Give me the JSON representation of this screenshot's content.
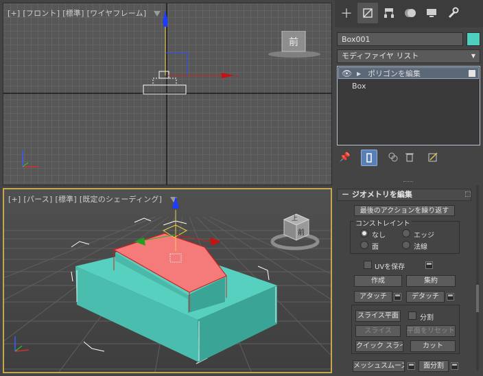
{
  "viewports": {
    "front": {
      "plus": "[+]",
      "view": "[フロント]",
      "mode": "[標準]",
      "shading": "[ワイヤフレーム]",
      "cube_label": "前"
    },
    "perspective": {
      "plus": "[+]",
      "view": "[パース]",
      "mode": "[標準]",
      "shading": "[既定のシェーディング]",
      "cube_label_top": "上",
      "cube_label_front": "前"
    }
  },
  "panel": {
    "tabs": [
      {
        "name": "create",
        "icon": "plus-icon"
      },
      {
        "name": "modify",
        "icon": "modify-icon"
      },
      {
        "name": "hierarchy",
        "icon": "hierarchy-icon"
      },
      {
        "name": "motion",
        "icon": "motion-icon"
      },
      {
        "name": "display",
        "icon": "display-icon"
      },
      {
        "name": "utilities",
        "icon": "wrench-icon"
      }
    ],
    "object_name": "Box001",
    "object_color": "#4fcfbe",
    "modifier_list": "モディファイヤ リスト",
    "stack": {
      "modifier": "ポリゴンを編集",
      "base": "Box"
    },
    "rollout_title": "ジオメトリを編集",
    "repeat_last": "最後のアクションを繰り返す",
    "constraints": {
      "title": "コンストレイント",
      "none": "なし",
      "edge": "エッジ",
      "face": "面",
      "normal": "法線"
    },
    "preserve_uv": "UVを保存",
    "create": "作成",
    "collapse": "集約",
    "attach": "アタッチ",
    "detach": "デタッチ",
    "slice_plane": "スライス平面",
    "split": "分割",
    "slice": "スライス",
    "reset_plane": "平面をリセット",
    "quick_slice": "クイック スライス",
    "cut": "カット",
    "meshsmooth": "メッシュスムーズ",
    "tessellate": "面分割"
  },
  "colors": {
    "accent": "#4fcfbe",
    "selection": "#f08080",
    "active_border": "#c8a64b"
  }
}
